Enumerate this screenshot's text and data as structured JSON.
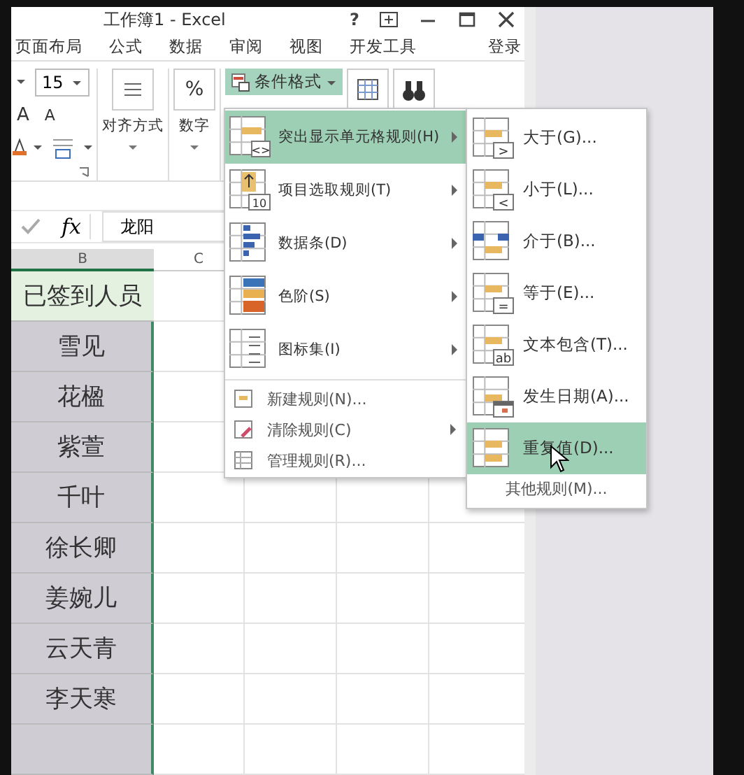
{
  "window": {
    "title": "工作簿1 - Excel",
    "help": "?"
  },
  "ribbon_tabs": [
    {
      "label": "页面布局"
    },
    {
      "label": "公式"
    },
    {
      "label": "数据"
    },
    {
      "label": "审阅"
    },
    {
      "label": "视图"
    },
    {
      "label": "开发工具"
    }
  ],
  "sign_in": "登录",
  "ribbon": {
    "font_size": "15",
    "grow_font": "A",
    "shrink_font": "A",
    "alignment_label": "对齐方式",
    "number_symbol": "%",
    "number_label": "数字",
    "conditional_format": {
      "label": "条件格式",
      "selected": true
    }
  },
  "formula_bar": {
    "fx": "fx",
    "value": "龙阳"
  },
  "columns": [
    "B",
    "C"
  ],
  "cells": [
    {
      "text": "已签到人员",
      "kind": "header"
    },
    {
      "text": "雪见",
      "kind": "name"
    },
    {
      "text": "花楹",
      "kind": "name"
    },
    {
      "text": "紫萱",
      "kind": "name"
    },
    {
      "text": "千叶",
      "kind": "name"
    },
    {
      "text": "徐长卿",
      "kind": "name"
    },
    {
      "text": "姜婉儿",
      "kind": "name"
    },
    {
      "text": "云天青",
      "kind": "name"
    },
    {
      "text": "李天寒",
      "kind": "name"
    }
  ],
  "menu": {
    "items": [
      {
        "label": "突出显示单元格规则(H)",
        "kind": "highlight",
        "badge": "<>",
        "selected": true
      },
      {
        "label": "项目选取规则(T)",
        "kind": "top",
        "badge": "10",
        "selected": false
      },
      {
        "label": "数据条(D)",
        "kind": "databar",
        "selected": false
      },
      {
        "label": "色阶(S)",
        "kind": "colorscale",
        "selected": false
      },
      {
        "label": "图标集(I)",
        "kind": "iconset",
        "selected": false
      }
    ],
    "rule_items": [
      {
        "label": "新建规则(N)...",
        "kind": "new",
        "submenu": false
      },
      {
        "label": "清除规则(C)",
        "kind": "clear",
        "submenu": true
      },
      {
        "label": "管理规则(R)...",
        "kind": "manage",
        "submenu": false
      }
    ]
  },
  "submenu": {
    "items": [
      {
        "label": "大于(G)...",
        "kind": "badge",
        "badge": ">",
        "selected": false
      },
      {
        "label": "小于(L)...",
        "kind": "badge",
        "badge": "<",
        "selected": false
      },
      {
        "label": "介于(B)...",
        "kind": "between",
        "selected": false
      },
      {
        "label": "等于(E)...",
        "kind": "badge",
        "badge": "=",
        "selected": false
      },
      {
        "label": "文本包含(T)...",
        "kind": "badge",
        "badge": "ab",
        "selected": false
      },
      {
        "label": "发生日期(A)...",
        "kind": "date",
        "selected": false
      },
      {
        "label": "重复值(D)...",
        "kind": "duplicate",
        "selected": true
      }
    ],
    "more": "其他规则(M)..."
  }
}
